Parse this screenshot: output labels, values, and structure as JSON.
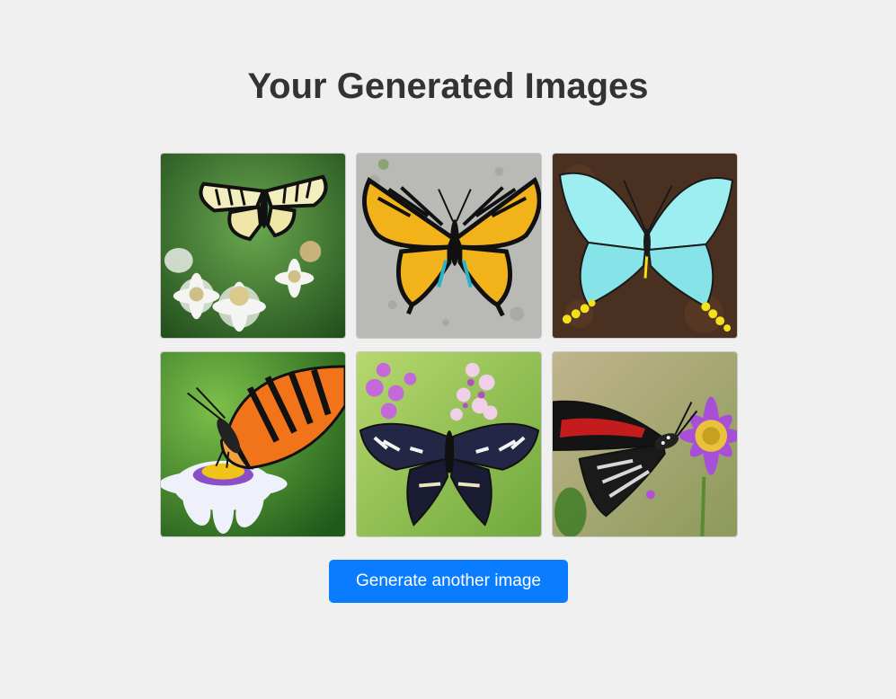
{
  "page": {
    "title": "Your Generated Images"
  },
  "gallery": {
    "images": [
      {
        "subject": "yellow-swallowtail-butterfly-on-white-daisies",
        "background": "#3f7a34"
      },
      {
        "subject": "yellow-black-butterfly-on-stone",
        "background": "#b7b7b4"
      },
      {
        "subject": "light-blue-butterfly-on-brown-texture",
        "background": "#4a3020"
      },
      {
        "subject": "orange-striped-butterfly-on-purple-daisy",
        "background": "#4c8c32"
      },
      {
        "subject": "dark-blue-butterfly-with-pink-flowers",
        "background": "#8fbf4a"
      },
      {
        "subject": "red-black-butterfly-on-purple-aster",
        "background": "#a89a70"
      }
    ]
  },
  "actions": {
    "generate_label": "Generate another image",
    "button_color": "#0a7cff"
  }
}
